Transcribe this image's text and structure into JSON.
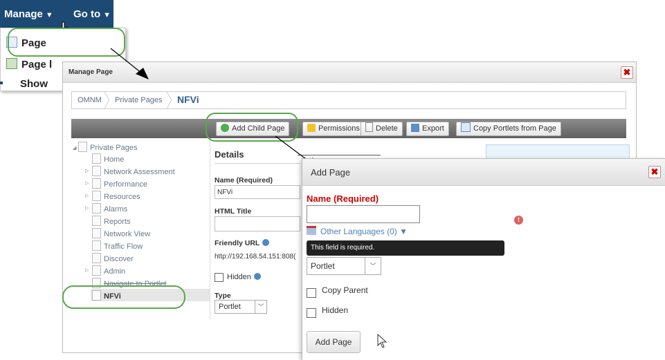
{
  "topbar": {
    "manage_label": "Manage",
    "goto_label": "Go to",
    "dropdown": [
      "Page",
      "Page l",
      "Show"
    ]
  },
  "manage_window": {
    "title": "Manage Page",
    "breadcrumb": [
      "OMNM",
      "Private Pages",
      "NFVi"
    ],
    "toolbar": {
      "add_child": "Add Child Page",
      "permissions": "Permissions",
      "delete": "Delete",
      "export": "Export",
      "copy_portlets": "Copy Portlets from Page"
    },
    "tree": {
      "root": "Private Pages",
      "items": [
        "Home",
        "Network Assessment",
        "Performance",
        "Resources",
        "Alarms",
        "Reports",
        "Network View",
        "Traffic Flow",
        "Discover",
        "Admin",
        "Navigate to Portlet",
        "NFVi"
      ]
    },
    "details": {
      "heading": "Details",
      "name_label": "Name (Required)",
      "name_value": "NFVi",
      "html_title_label": "HTML Title",
      "friendly_url_label": "Friendly URL",
      "friendly_url_value": "http://192.168.54.151:808(",
      "hidden_label": "Hidden",
      "type_label": "Type",
      "type_value": "Portlet"
    }
  },
  "add_page": {
    "title": "Add Page",
    "name_label": "Name (Required)",
    "other_languages": "Other Languages (0) ▼",
    "error_tooltip": "This field is required.",
    "type_value": "Portlet",
    "copy_parent_label": "Copy Parent",
    "hidden_label": "Hidden",
    "submit_label": "Add Page"
  },
  "colors": {
    "topbar": "#1c4a74",
    "highlight": "#5aa84a",
    "error": "#cc0000",
    "link": "#4d7fb8"
  }
}
